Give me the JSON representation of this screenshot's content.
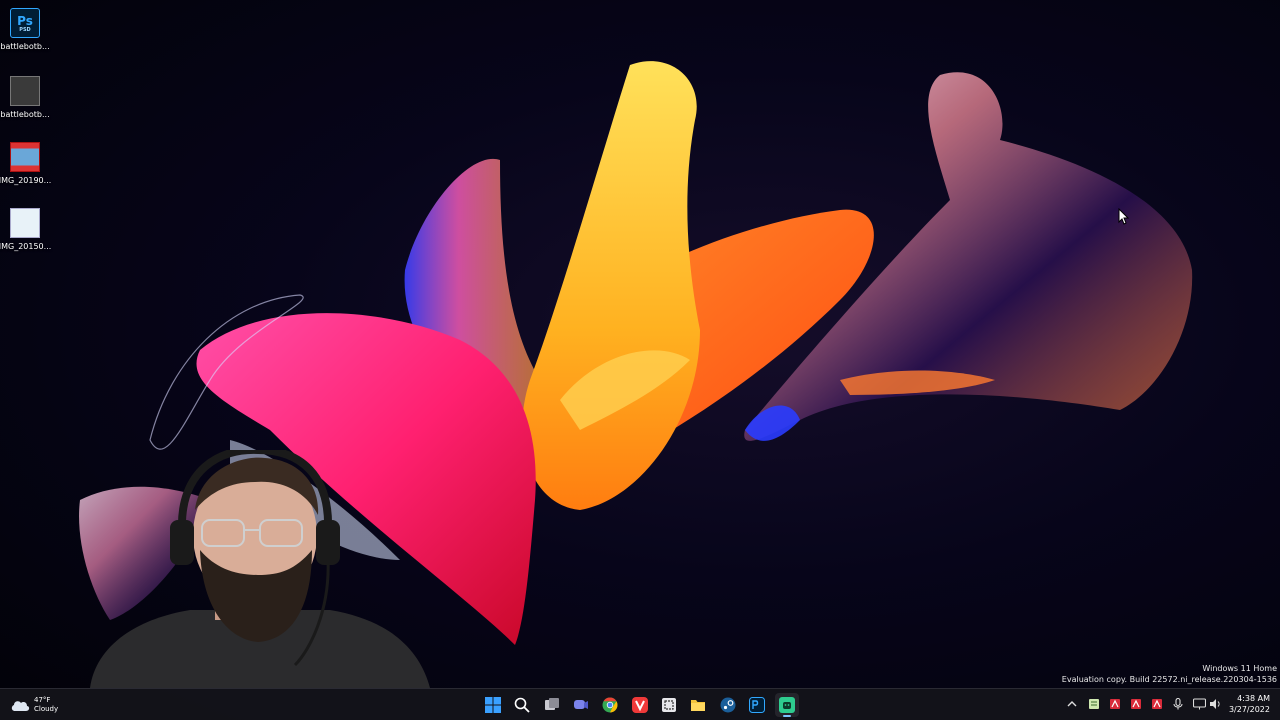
{
  "desktop_icons": [
    {
      "label": "battlebotb...",
      "icon": "photoshop-file-icon"
    },
    {
      "label": "battlebotb...",
      "icon": "document-thumbnail-icon"
    },
    {
      "label": "IMG_20190...",
      "icon": "image-file-icon"
    },
    {
      "label": "IMG_20150...",
      "icon": "image-file-icon"
    }
  ],
  "photoshop_glyph": "Ps",
  "photoshop_sub": "PSD",
  "watermark": {
    "line1": "Windows 11 Home",
    "line2": "Evaluation copy. Build 22572.ni_release.220304-1536"
  },
  "taskbar": {
    "weather_temp": "47°F",
    "weather_desc": "Cloudy",
    "apps": [
      "start-icon",
      "search-icon",
      "task-view-icon",
      "chat-icon",
      "chrome-icon",
      "vivaldi-icon",
      "snipping-tool-icon",
      "file-explorer-icon",
      "steam-icon",
      "photoshop-icon",
      "android-app-icon"
    ],
    "clock_time": "4:38 AM",
    "clock_date": "3/27/2022"
  },
  "colors": {
    "accent": "#7cc4ff",
    "photoshop": "#31a8ff",
    "taskbar": "#14141a"
  }
}
